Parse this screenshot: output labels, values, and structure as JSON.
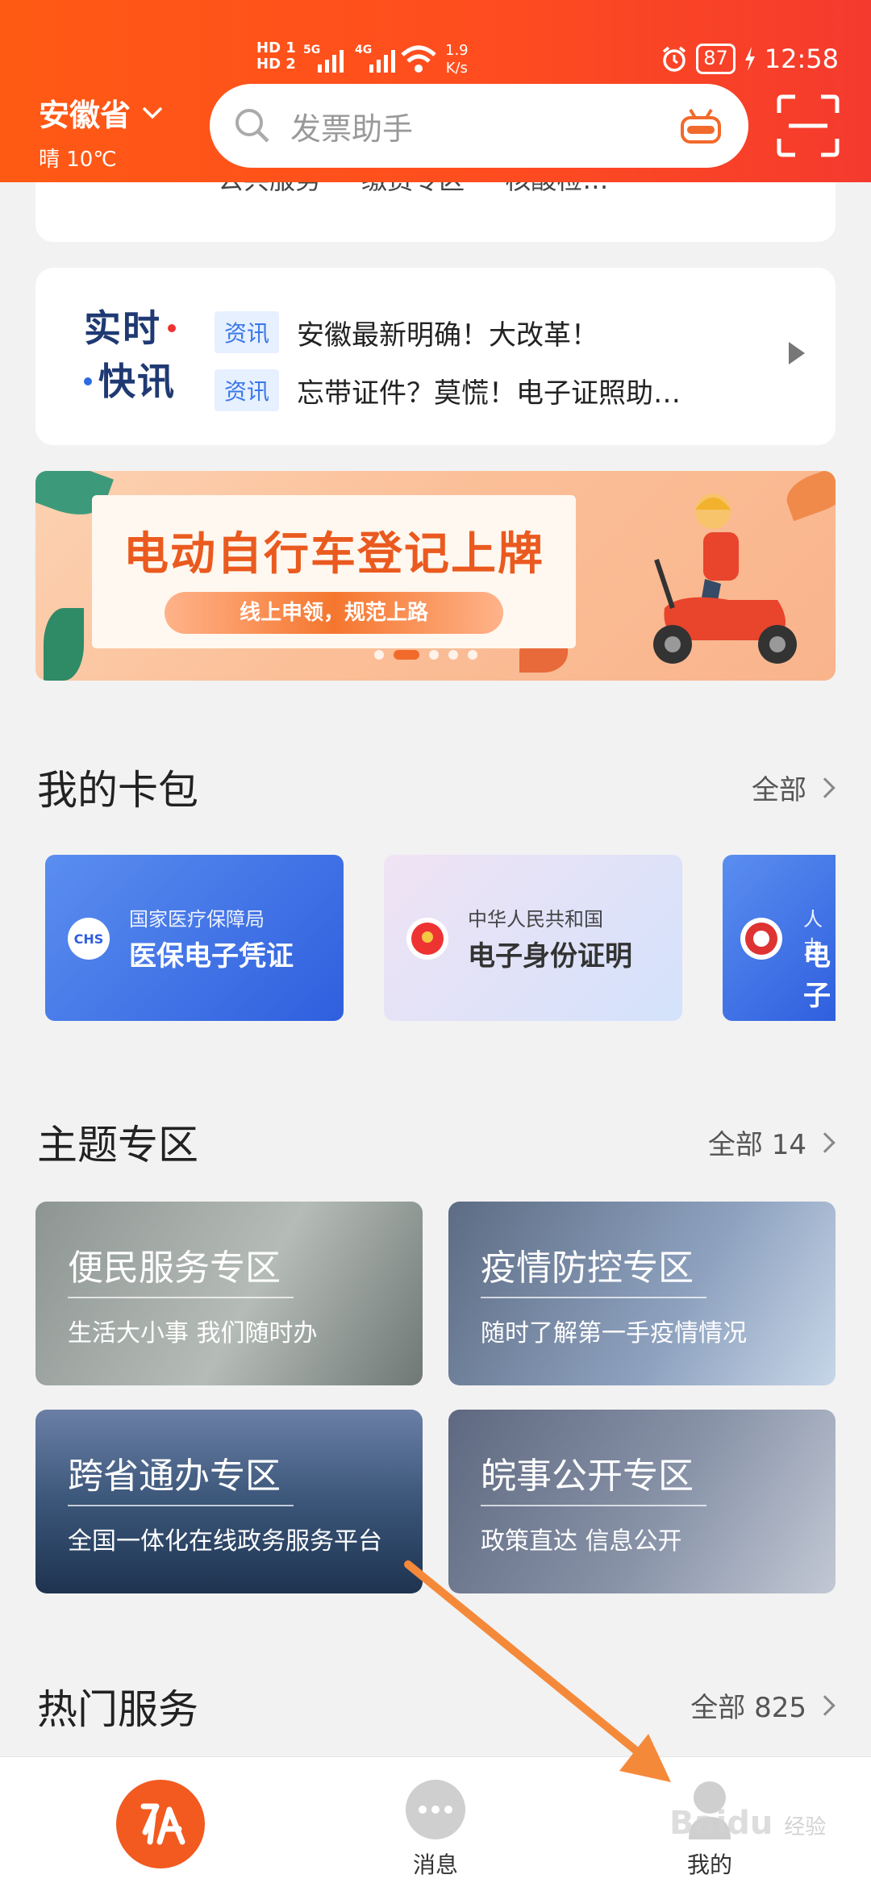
{
  "status_bar": {
    "net1": "HD 1",
    "net2": "HD 2",
    "gen1": "5G",
    "gen2": "4G",
    "speed_value": "1.9",
    "speed_unit": "K/s",
    "battery": "87",
    "time": "12:58"
  },
  "header": {
    "location": "安徽省",
    "weather": "晴 10℃",
    "search_placeholder": "发票助手"
  },
  "top_stub": {
    "text": "公共服务 缴费专区 核酸检…"
  },
  "news": {
    "logo_line1": "实时",
    "logo_line2": "快讯",
    "items": [
      {
        "tag": "资讯",
        "text": "安徽最新明确！大改革！"
      },
      {
        "tag": "资讯",
        "text": "忘带证件？莫慌！电子证照助…"
      }
    ]
  },
  "banner": {
    "title": "电动自行车登记上牌",
    "subtitle": "线上申领，规范上路",
    "slide_count": 5,
    "active_slide": 1
  },
  "card_wallet": {
    "title": "我的卡包",
    "more_label": "全部",
    "cards": [
      {
        "org": "国家医疗保障局",
        "name": "医保电子凭证",
        "emblem": "CHS"
      },
      {
        "org": "中华人民共和国",
        "name": "电子身份证明",
        "emblem": ""
      },
      {
        "org": "人力",
        "name": "电子",
        "emblem": ""
      }
    ]
  },
  "themes": {
    "title": "主题专区",
    "more_label": "全部 14",
    "items": [
      {
        "title": "便民服务专区",
        "subtitle": "生活大小事 我们随时办"
      },
      {
        "title": "疫情防控专区",
        "subtitle": "随时了解第一手疫情情况"
      },
      {
        "title": "跨省通办专区",
        "subtitle": "全国一体化在线政务服务平台"
      },
      {
        "title": "皖事公开专区",
        "subtitle": "政策直达 信息公开"
      }
    ]
  },
  "hot_services": {
    "title": "热门服务",
    "more_label": "全部 825"
  },
  "bottom_nav": {
    "items": [
      {
        "label": "消息",
        "icon": "chat-icon"
      },
      {
        "label": "我的",
        "icon": "user-icon"
      }
    ]
  },
  "watermark": {
    "brand": "Baidu",
    "sub": "经验"
  },
  "colors": {
    "brand": "#ff5a14",
    "tag_bg": "#e6f0ff",
    "tag_text": "#3a78e8"
  }
}
